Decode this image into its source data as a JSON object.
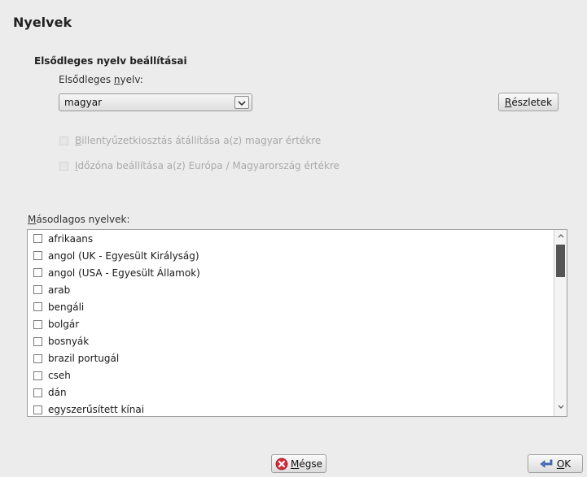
{
  "page": {
    "title": "Nyelvek"
  },
  "primary": {
    "section_title": "Elsődleges nyelv beállításai",
    "label_prefix": "Elsődleges ",
    "label_mnemonic": "n",
    "label_suffix": "yelv:",
    "selected": "magyar",
    "details_mnemonic": "R",
    "details_rest": "észletek",
    "opt_keyboard_mnemonic": "B",
    "opt_keyboard_rest": "illentyűzetkiosztás átállítása a(z) magyar értékre",
    "opt_timezone_mnemonic": "I",
    "opt_timezone_rest": "dőzóna beállítása a(z) Európa / Magyarország értékre"
  },
  "secondary": {
    "label_mnemonic": "M",
    "label_rest": "ásodlagos nyelvek:",
    "items": [
      "afrikaans",
      "angol (UK - Egyesült Királyság)",
      "angol (USA - Egyesült Államok)",
      "arab",
      "bengáli",
      "bolgár",
      "bosnyák",
      "brazil portugál",
      "cseh",
      "dán",
      "egyszerűsített kínai"
    ]
  },
  "buttons": {
    "cancel_mnemonic": "M",
    "cancel_rest": "égse",
    "ok_mnemonic": "O",
    "ok_rest": "K"
  },
  "colors": {
    "cancel_icon": "#d8283a",
    "ok_icon": "#4a78c8"
  },
  "icons": {
    "combo_arrow": "chevron-down-icon",
    "cancel": "cancel-icon",
    "ok": "ok-arrow-icon",
    "scroll_up": "chevron-up-icon",
    "scroll_down": "chevron-down-icon"
  }
}
